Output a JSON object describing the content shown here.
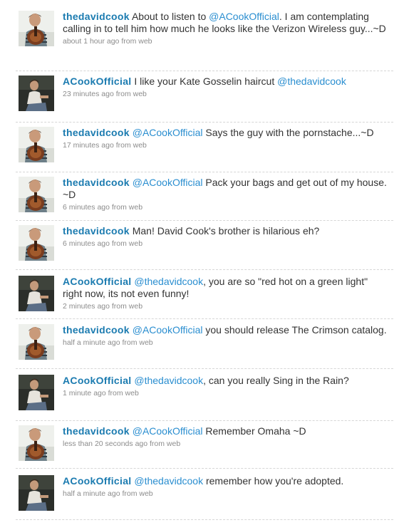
{
  "tweets": [
    {
      "user": "thedavidcook",
      "avatar": "guitar-guy-avatar",
      "parts": [
        {
          "t": "text",
          "v": " About to listen to "
        },
        {
          "t": "mention",
          "v": "@ACookOfficial"
        },
        {
          "t": "text",
          "v": ". I am contemplating calling in to tell him how much he looks like the Verizon Wireless guy...~D"
        }
      ],
      "meta": "about 1 hour ago from web"
    },
    {
      "user": "ACookOfficial",
      "avatar": "sitting-guy-avatar",
      "parts": [
        {
          "t": "text",
          "v": " I like your Kate Gosselin haircut "
        },
        {
          "t": "mention",
          "v": "@thedavidcook"
        }
      ],
      "meta": "23 minutes ago from web"
    },
    {
      "user": "thedavidcook",
      "avatar": "guitar-guy-avatar",
      "parts": [
        {
          "t": "text",
          "v": " "
        },
        {
          "t": "mention",
          "v": "@ACookOfficial"
        },
        {
          "t": "text",
          "v": " Says the guy with the pornstache...~D"
        }
      ],
      "meta": "17 minutes ago from web"
    },
    {
      "user": "thedavidcook",
      "avatar": "guitar-guy-avatar",
      "parts": [
        {
          "t": "text",
          "v": " "
        },
        {
          "t": "mention",
          "v": "@ACookOfficial"
        },
        {
          "t": "text",
          "v": " Pack your bags and get out of my house. ~D"
        }
      ],
      "meta": "6 minutes ago from web"
    },
    {
      "user": "thedavidcook",
      "avatar": "guitar-guy-avatar",
      "parts": [
        {
          "t": "text",
          "v": " Man! David Cook's brother is hilarious eh?"
        }
      ],
      "meta": "6 minutes ago from web"
    },
    {
      "user": "ACookOfficial",
      "avatar": "sitting-guy-avatar",
      "parts": [
        {
          "t": "text",
          "v": " "
        },
        {
          "t": "mention",
          "v": "@thedavidcook"
        },
        {
          "t": "text",
          "v": ", you are so \"red hot on a green light\" right now, its not even funny!"
        }
      ],
      "meta": "2 minutes ago from web"
    },
    {
      "user": "thedavidcook",
      "avatar": "guitar-guy-avatar",
      "parts": [
        {
          "t": "text",
          "v": " "
        },
        {
          "t": "mention",
          "v": "@ACookOfficial"
        },
        {
          "t": "text",
          "v": " you should release The Crimson catalog."
        }
      ],
      "meta": "half a minute ago from web"
    },
    {
      "user": "ACookOfficial",
      "avatar": "sitting-guy-avatar",
      "parts": [
        {
          "t": "text",
          "v": " "
        },
        {
          "t": "mention",
          "v": "@thedavidcook"
        },
        {
          "t": "text",
          "v": ", can you really Sing in the Rain?"
        }
      ],
      "meta": "1 minute ago from web"
    },
    {
      "user": "thedavidcook",
      "avatar": "guitar-guy-avatar",
      "parts": [
        {
          "t": "text",
          "v": " "
        },
        {
          "t": "mention",
          "v": "@ACookOfficial"
        },
        {
          "t": "text",
          "v": " Remember Omaha ~D"
        }
      ],
      "meta": "less than 20 seconds ago from web"
    },
    {
      "user": "ACookOfficial",
      "avatar": "sitting-guy-avatar",
      "parts": [
        {
          "t": "text",
          "v": " "
        },
        {
          "t": "mention",
          "v": "@thedavidcook"
        },
        {
          "t": "text",
          "v": " remember how you're adopted."
        }
      ],
      "meta": "half a minute ago from web"
    }
  ]
}
